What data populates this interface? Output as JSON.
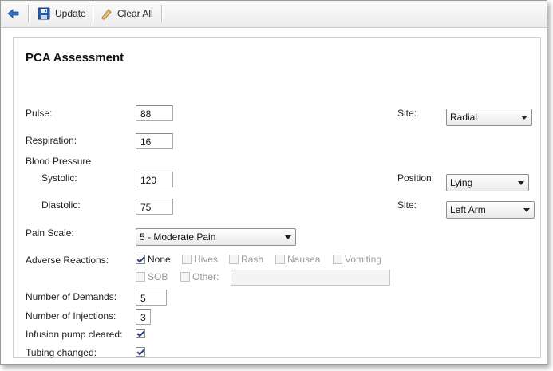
{
  "toolbar": {
    "update_label": "Update",
    "clear_label": "Clear All"
  },
  "form": {
    "title": "PCA Assessment",
    "pulse": {
      "label": "Pulse:",
      "value": "88"
    },
    "respiration": {
      "label": "Respiration:",
      "value": "16"
    },
    "blood_pressure": {
      "label": "Blood Pressure"
    },
    "systolic": {
      "label": "Systolic:",
      "value": "120"
    },
    "diastolic": {
      "label": "Diastolic:",
      "value": "75"
    },
    "pulse_site": {
      "label": "Site:",
      "value": "Radial"
    },
    "position": {
      "label": "Position:",
      "value": "Lying"
    },
    "bp_site": {
      "label": "Site:",
      "value": "Left Arm"
    },
    "pain_scale": {
      "label": "Pain Scale:",
      "value": "5 - Moderate Pain"
    },
    "adverse_reactions": {
      "label": "Adverse Reactions:",
      "options": [
        {
          "label": "None",
          "checked": true,
          "enabled": true
        },
        {
          "label": "Hives",
          "checked": false,
          "enabled": false
        },
        {
          "label": "Rash",
          "checked": false,
          "enabled": false
        },
        {
          "label": "Nausea",
          "checked": false,
          "enabled": false
        },
        {
          "label": "Vomiting",
          "checked": false,
          "enabled": false
        },
        {
          "label": "SOB",
          "checked": false,
          "enabled": false
        },
        {
          "label": "Other:",
          "checked": false,
          "enabled": false
        }
      ],
      "other_value": ""
    },
    "demands": {
      "label": "Number of Demands:",
      "value": "5"
    },
    "injections": {
      "label": "Number of Injections:",
      "value": "3"
    },
    "pump_cleared": {
      "label": "Infusion pump cleared:",
      "checked": true
    },
    "tubing_changed": {
      "label": "Tubing changed:",
      "checked": true
    }
  }
}
